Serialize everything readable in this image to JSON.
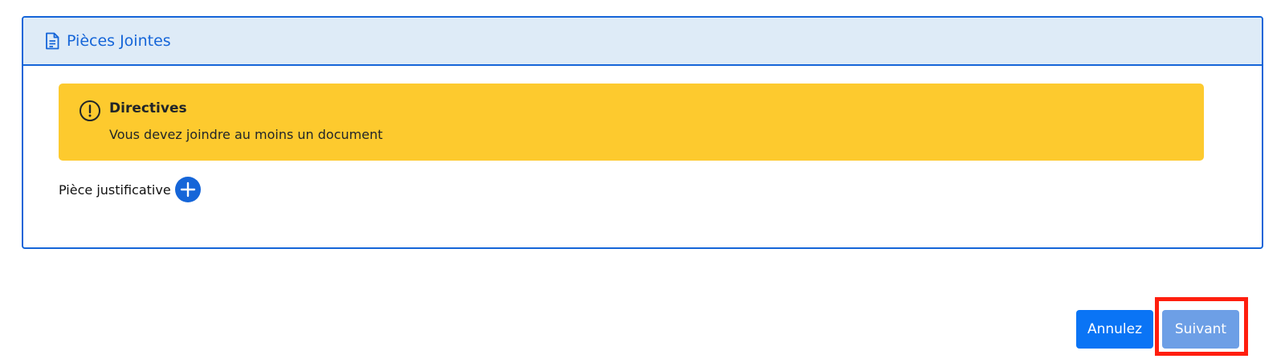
{
  "section": {
    "title": "Pièces Jointes",
    "icon": "document-icon"
  },
  "alert": {
    "title": "Directives",
    "message": "Vous devez joindre au moins un document",
    "icon": "exclamation-circle-icon",
    "color": "#fdca2e"
  },
  "attachment": {
    "label": "Pièce justificative",
    "add_icon": "plus-circle-icon"
  },
  "actions": {
    "cancel_label": "Annulez",
    "next_label": "Suivant"
  },
  "colors": {
    "primary": "#1565d8",
    "header_bg": "#deebf7",
    "next_disabled": "#6d9fe6",
    "highlight": "#ff1e0e"
  }
}
